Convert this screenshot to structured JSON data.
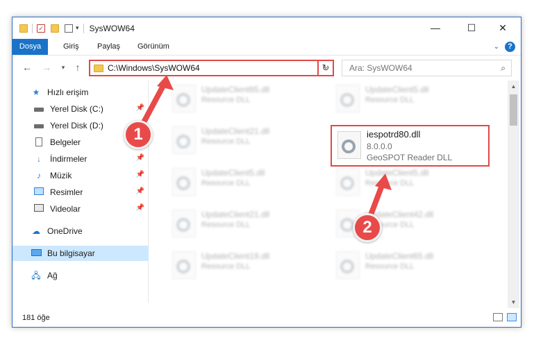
{
  "window": {
    "title": "SysWOW64",
    "controls": {
      "minimize": "—",
      "maximize": "☐",
      "close": "✕"
    }
  },
  "ribbon": {
    "tabs": [
      "Dosya",
      "Giriş",
      "Paylaş",
      "Görünüm"
    ],
    "help": "?"
  },
  "nav": {
    "address": "C:\\Windows\\SysWOW64",
    "search_placeholder": "Ara: SysWOW64"
  },
  "sidebar": {
    "items": [
      {
        "label": "Hızlı erişim",
        "icon": "star-icon"
      },
      {
        "label": "Yerel Disk (C:)",
        "icon": "drive-icon"
      },
      {
        "label": "Yerel Disk (D:)",
        "icon": "drive-icon"
      },
      {
        "label": "Belgeler",
        "icon": "document-icon"
      },
      {
        "label": "İndirmeler",
        "icon": "download-icon"
      },
      {
        "label": "Müzik",
        "icon": "music-icon"
      },
      {
        "label": "Resimler",
        "icon": "pictures-icon"
      },
      {
        "label": "Videolar",
        "icon": "video-icon"
      },
      {
        "label": "OneDrive",
        "icon": "cloud-icon"
      },
      {
        "label": "Bu bilgisayar",
        "icon": "computer-icon"
      },
      {
        "label": "Ağ",
        "icon": "network-icon"
      }
    ]
  },
  "files": {
    "left": [
      {
        "name": "UpdateClient65.dll",
        "desc": "Resource DLL"
      },
      {
        "name": "UpdateClient21.dll",
        "desc": "Resource DLL"
      },
      {
        "name": "UpdateClient5.dll",
        "desc": "Resource DLL"
      },
      {
        "name": "UpdateClient21.dll",
        "desc": "Resource DLL"
      },
      {
        "name": "UpdateClient19.dll",
        "desc": "Resource DLL"
      }
    ],
    "right": [
      {
        "name": "UpdateClient5.dll",
        "desc": "Resource DLL"
      },
      {
        "name": "UpdateClient5.dll",
        "desc": "Resource DLL"
      },
      {
        "name": "UpdateClient42.dll",
        "desc": "Resource DLL"
      },
      {
        "name": "UpdateClient65.dll",
        "desc": "Resource DLL"
      }
    ],
    "highlighted": {
      "name": "iespotrd80.dll",
      "version": "8.0.0.0",
      "desc": "GeoSPOT Reader DLL"
    }
  },
  "status": {
    "count": "181 öğe"
  },
  "annotations": {
    "step1": "1",
    "step2": "2",
    "color": "#e84a4a"
  }
}
